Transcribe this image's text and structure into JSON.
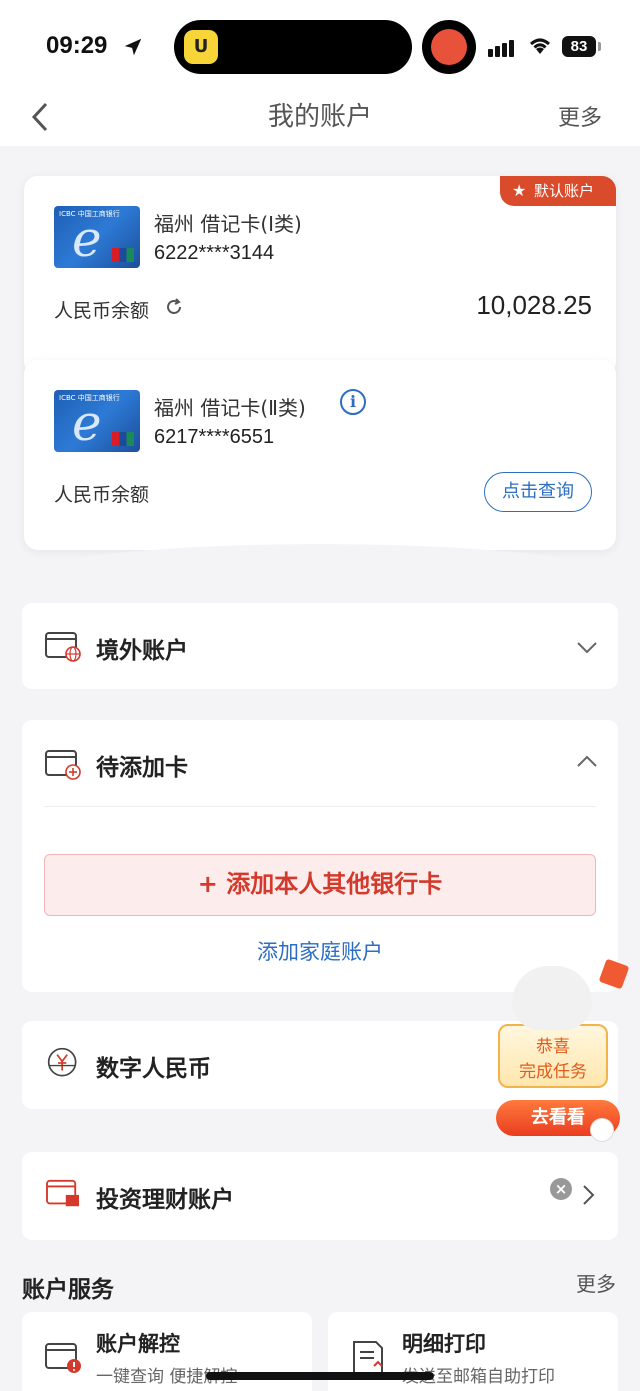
{
  "status": {
    "time": "09:29",
    "battery": "83"
  },
  "nav": {
    "title": "我的账户",
    "more": "更多"
  },
  "accounts": [
    {
      "badge": "默认账户",
      "name": "福州 借记卡(Ⅰ类)",
      "number": "6222****3144",
      "balance_label": "人民币余额",
      "balance": "10,028.25"
    },
    {
      "name": "福州 借记卡(Ⅱ类)",
      "number": "6217****6551",
      "balance_label": "人民币余额",
      "query_label": "点击查询"
    }
  ],
  "card_brand_text": "ICBC 中国工商银行",
  "sections": {
    "overseas": {
      "title": "境外账户"
    },
    "pending": {
      "title": "待添加卡",
      "add_card": "+ 添加本人其他银行卡",
      "add_family": "添加家庭账户"
    },
    "ecny": {
      "title": "数字人民币"
    },
    "invest": {
      "title": "投资理财账户"
    }
  },
  "services": {
    "title": "账户服务",
    "more": "更多",
    "items": [
      {
        "title": "账户解控",
        "subtitle": "一键查询 便捷解控"
      },
      {
        "title": "明细打印",
        "subtitle": "发送至邮箱自助打印"
      }
    ]
  },
  "promo": {
    "line1": "恭喜",
    "line2": "完成任务",
    "button": "去看看"
  },
  "colors": {
    "accent_red": "#d43a2c",
    "accent_blue": "#2b6ec2",
    "badge": "#d94b2b"
  }
}
